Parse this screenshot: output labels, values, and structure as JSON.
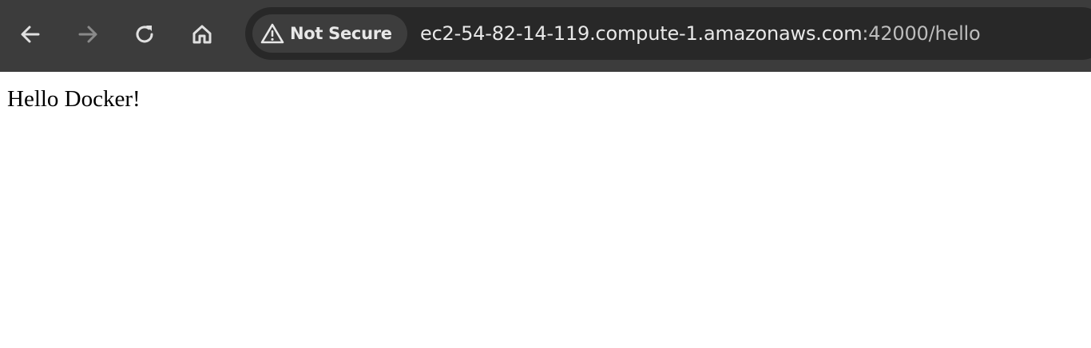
{
  "browser": {
    "security_label": "Not Secure",
    "url_host": "ec2-54-82-14-119.compute-1.amazonaws.com",
    "url_path": ":42000/hello",
    "colors": {
      "toolbar": "#3c3c3c",
      "omnibox": "#282828",
      "chip": "#3d3d3d",
      "text": "#e8e8e8",
      "icon_enabled": "#e0e0e0",
      "icon_disabled": "#8a8a8a"
    },
    "icons": {
      "back": "arrow-left-icon",
      "forward": "arrow-right-icon",
      "reload": "reload-icon",
      "home": "home-icon",
      "security": "warning-triangle-icon"
    }
  },
  "page": {
    "body_text": "Hello Docker!"
  }
}
